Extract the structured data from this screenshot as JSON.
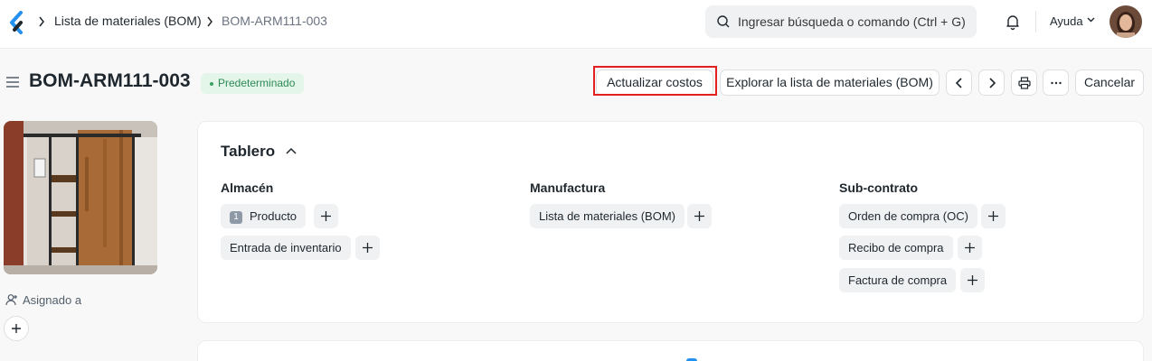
{
  "breadcrumb": {
    "items": [
      "Lista de materiales (BOM)",
      "BOM-ARM111-003"
    ]
  },
  "search": {
    "placeholder": "Ingresar búsqueda o comando (Ctrl + G)"
  },
  "navbar": {
    "help_label": "Ayuda"
  },
  "page": {
    "title": "BOM-ARM111-003",
    "status_badge": "Predeterminado"
  },
  "toolbar": {
    "update_costs_label": "Actualizar costos",
    "explore_bom_label": "Explorar la lista de materiales (BOM)",
    "cancel_label": "Cancelar"
  },
  "sidebar": {
    "assigned_label": "Asignado a"
  },
  "dashboard": {
    "title": "Tablero",
    "columns": [
      {
        "title": "Almacén",
        "links": [
          {
            "label": "Producto",
            "count": "1"
          },
          {
            "label": "Entrada de inventario"
          }
        ]
      },
      {
        "title": "Manufactura",
        "links": [
          {
            "label": "Lista de materiales (BOM)"
          }
        ]
      },
      {
        "title": "Sub-contrato",
        "links": [
          {
            "label": "Orden de compra (OC)"
          },
          {
            "label": "Recibo de compra"
          },
          {
            "label": "Factura de compra"
          }
        ]
      }
    ]
  },
  "colors": {
    "accent": "#2490ef",
    "highlight": "#e31f1f",
    "badge_text": "#2e8b57",
    "badge_bg": "#e4f5e9"
  }
}
